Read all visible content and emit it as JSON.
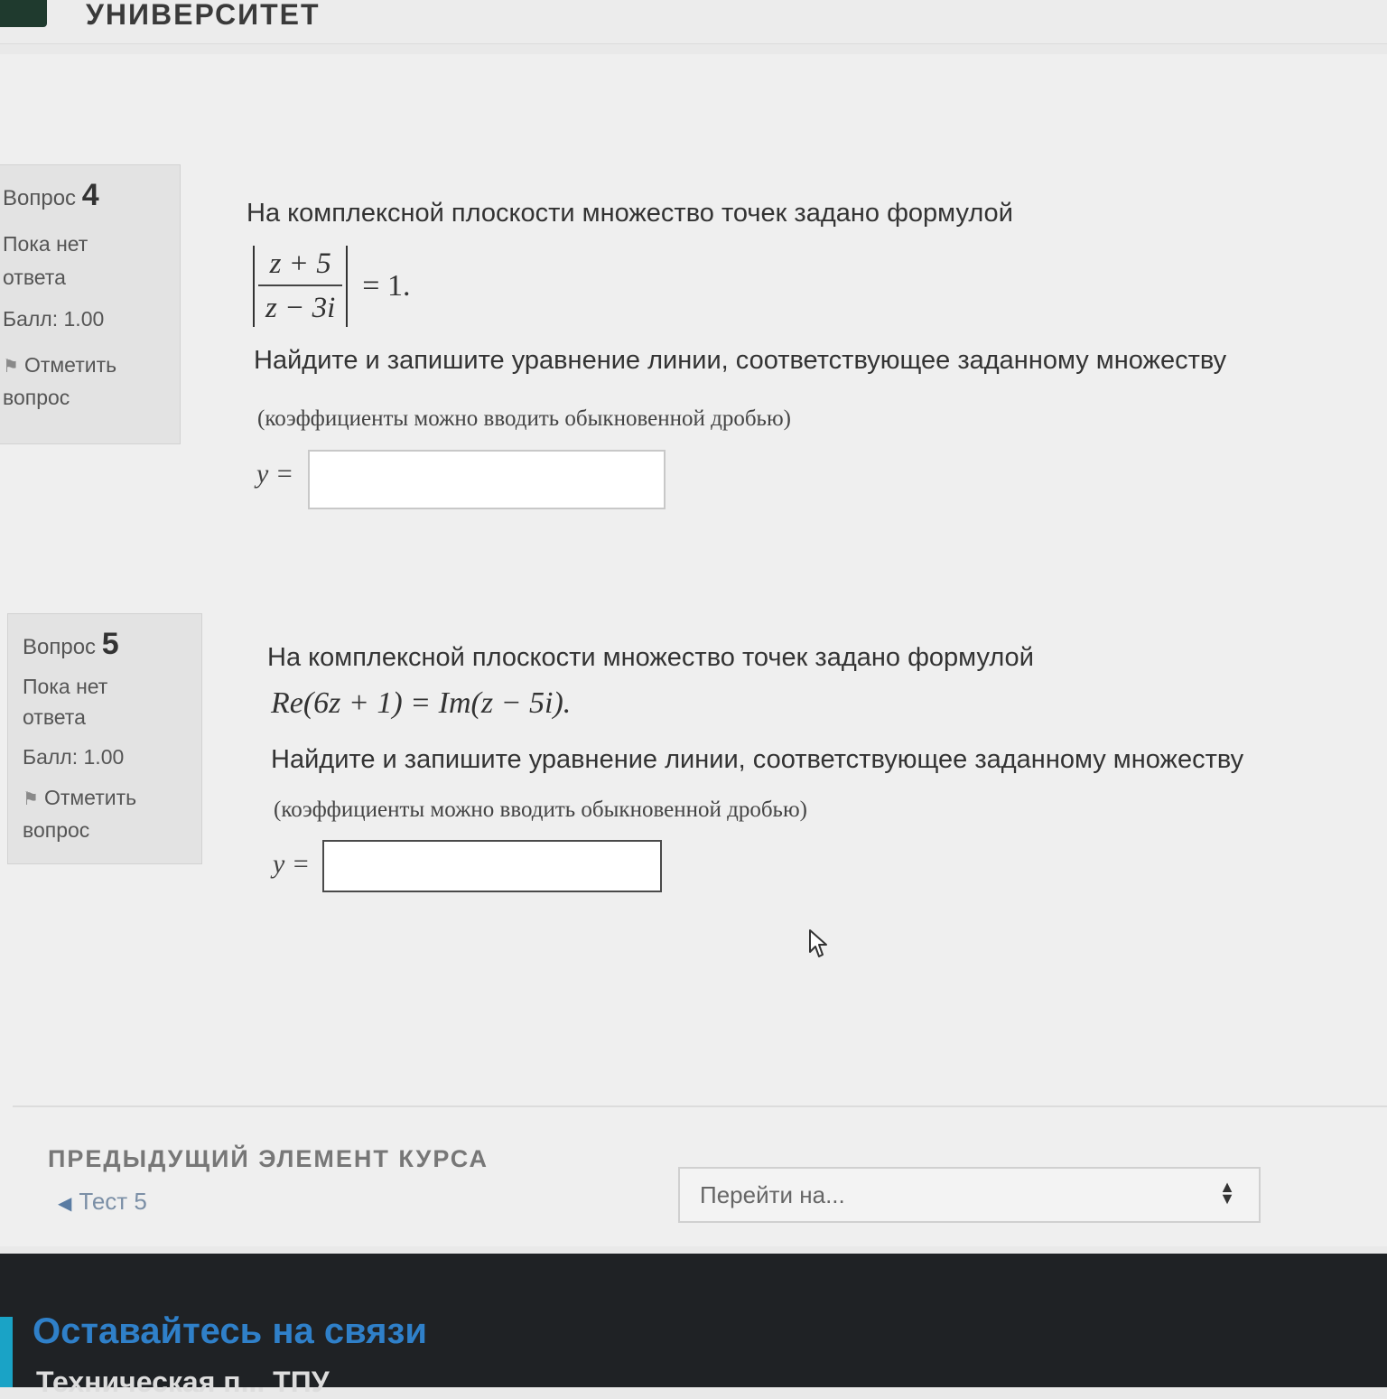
{
  "header": {
    "site_title": "УНИВЕРСИТЕТ"
  },
  "questions": [
    {
      "label": "Вопрос",
      "number": "4",
      "state_line1": "Пока нет",
      "state_line2": "ответа",
      "grade": "Балл: 1.00",
      "flag_line1": "Отметить",
      "flag_line2": "вопрос",
      "text": "На комплексной плоскости множество точек задано формулой",
      "formula_num": "z + 5",
      "formula_den": "z − 3i",
      "formula_rhs": "= 1.",
      "task": "Найдите и запишите уравнение линии, соответствующее заданному множеству",
      "hint": "(коэффициенты можно вводить обыкновенной дробью)",
      "answer_label": "y =",
      "answer_value": ""
    },
    {
      "label": "Вопрос",
      "number": "5",
      "state_line1": "Пока нет",
      "state_line2": "ответа",
      "grade": "Балл: 1.00",
      "flag_line1": "Отметить",
      "flag_line2": "вопрос",
      "text": "На комплексной плоскости множество точек задано формулой",
      "formula": "Re(6z + 1) = Im(z − 5i).",
      "task": "Найдите и запишите уравнение линии, соответствующее заданному множеству",
      "hint": "(коэффициенты можно вводить обыкновенной дробью)",
      "answer_label": "y =",
      "answer_value": ""
    }
  ],
  "navigation": {
    "prev_section_label": "ПРЕДЫДУЩИЙ ЭЛЕМЕНТ КУРСА",
    "prev_link": "Тест 5",
    "jump_select": "Перейти на..."
  },
  "footer": {
    "title": "Оставайтесь на связи",
    "subtitle": "Техническая п... ТПУ"
  },
  "icons": {
    "flag": "flag-icon",
    "prev": "triangle-left-icon",
    "select": "updown-icon",
    "cursor": "mouse-cursor-icon"
  }
}
